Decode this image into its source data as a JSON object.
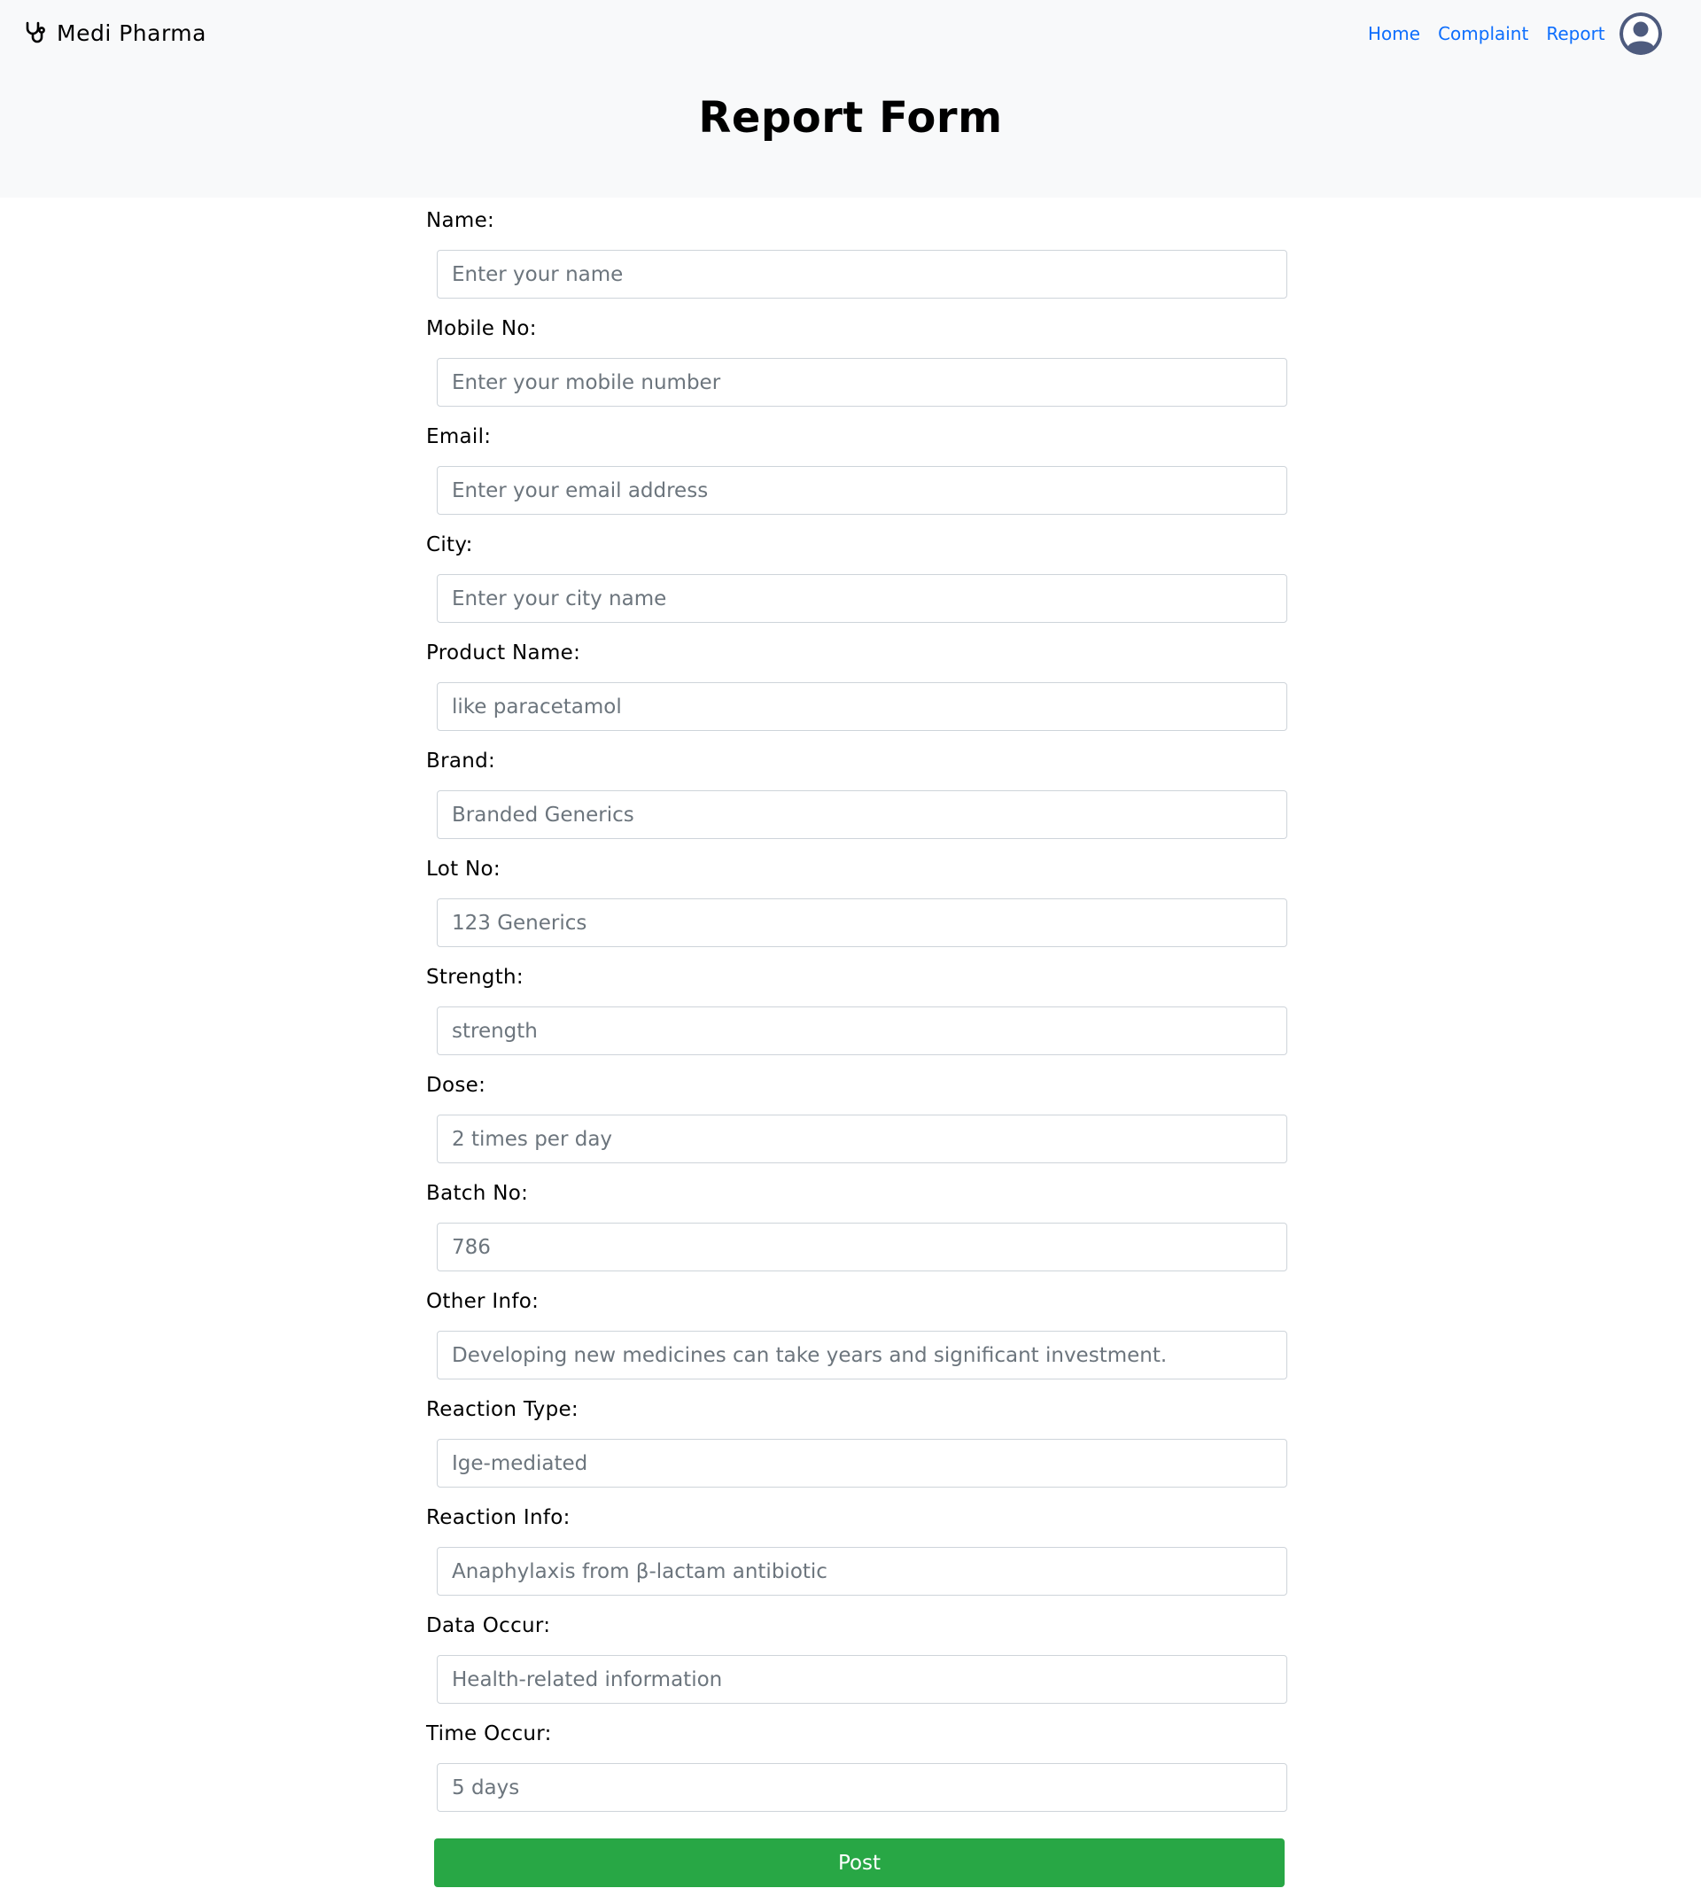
{
  "header": {
    "brand": "Medi Pharma",
    "nav": [
      "Home",
      "Complaint",
      "Report"
    ],
    "title": "Report Form"
  },
  "form": {
    "fields": [
      {
        "label": "Name:",
        "placeholder": "Enter your name"
      },
      {
        "label": "Mobile No:",
        "placeholder": "Enter your mobile number"
      },
      {
        "label": "Email:",
        "placeholder": "Enter your email address"
      },
      {
        "label": "City:",
        "placeholder": "Enter your city name"
      },
      {
        "label": "Product Name:",
        "placeholder": "like paracetamol"
      },
      {
        "label": "Brand:",
        "placeholder": "Branded Generics"
      },
      {
        "label": "Lot No:",
        "placeholder": "123 Generics"
      },
      {
        "label": "Strength:",
        "placeholder": "strength"
      },
      {
        "label": "Dose:",
        "placeholder": "2 times per day"
      },
      {
        "label": "Batch No:",
        "placeholder": "786"
      },
      {
        "label": "Other Info:",
        "placeholder": "Developing new medicines can take years and significant investment."
      },
      {
        "label": "Reaction Type:",
        "placeholder": "Ige-mediated"
      },
      {
        "label": "Reaction Info:",
        "placeholder": "Anaphylaxis from β-lactam antibiotic"
      },
      {
        "label": "Data Occur:",
        "placeholder": "Health-related information"
      },
      {
        "label": "Time Occur:",
        "placeholder": "5 days"
      }
    ],
    "submit_label": "Post"
  },
  "icons": {
    "brand": "stethoscope-icon",
    "avatar": "user-avatar-icon"
  },
  "colors": {
    "header_bg": "#f8f9fa",
    "link": "#0d6efd",
    "submit": "#28a745",
    "avatar": "#4e5b7e"
  }
}
